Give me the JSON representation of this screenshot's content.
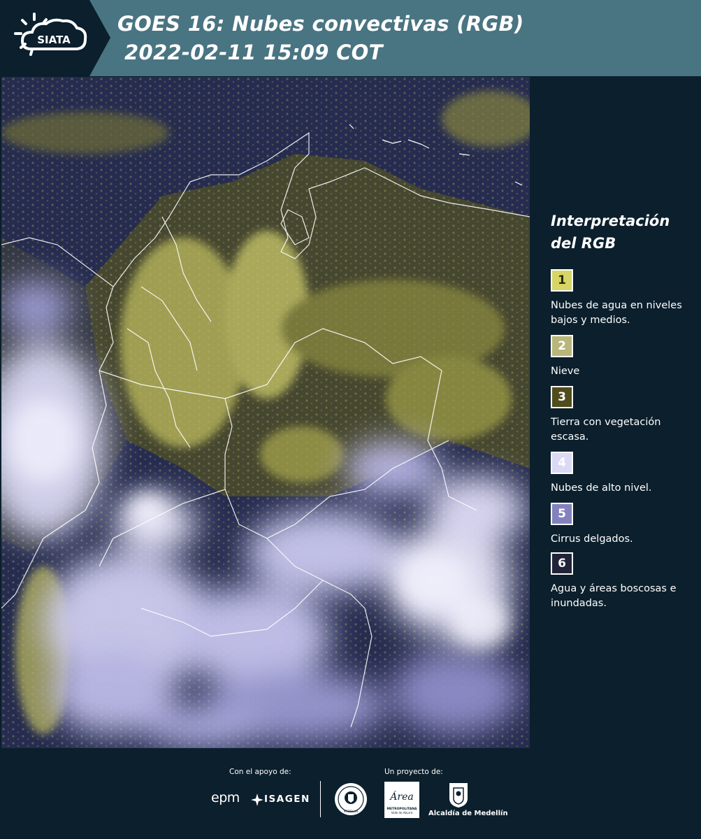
{
  "header": {
    "logo_text": "SIATA",
    "title_line1": "GOES 16: Nubes convectivas (RGB)",
    "title_line2": "2022-02-11 15:09 COT",
    "background_color": "#497482"
  },
  "map": {
    "icon": "satellite-rgb-image"
  },
  "legend": {
    "title_line1": "Interpretación",
    "title_line2": "del RGB",
    "items": [
      {
        "number": "1",
        "label": "Nubes de agua en niveles bajos y medios.",
        "color": "#d7d565",
        "text_color": "#2a2a10"
      },
      {
        "number": "2",
        "label": "Nieve",
        "color": "#b8b67a",
        "text_color": "#ffffff"
      },
      {
        "number": "3",
        "label": "Tierra con vegetación escasa.",
        "color": "#4f4d1c",
        "text_color": "#ffffff"
      },
      {
        "number": "4",
        "label": "Nubes de alto nivel.",
        "color": "#dad9f6",
        "text_color": "#ffffff"
      },
      {
        "number": "5",
        "label": "Cirrus delgados.",
        "color": "#8482bd",
        "text_color": "#ffffff"
      },
      {
        "number": "6",
        "label": "Agua y áreas boscosas e inundadas.",
        "color": "#212438",
        "text_color": "#ffffff"
      }
    ]
  },
  "footer": {
    "support_label": "Con el apoyo de:",
    "project_label": "Un proyecto de:",
    "epm_text": "epm",
    "isagen_text": "ISAGEN",
    "area_text": "Área",
    "area_sub": "METROPOLITANA",
    "area_sub2": "Valle de Aburrá",
    "alcaldia_text": "Alcaldía de Medellín",
    "seal_text": "MEDELLIN"
  }
}
